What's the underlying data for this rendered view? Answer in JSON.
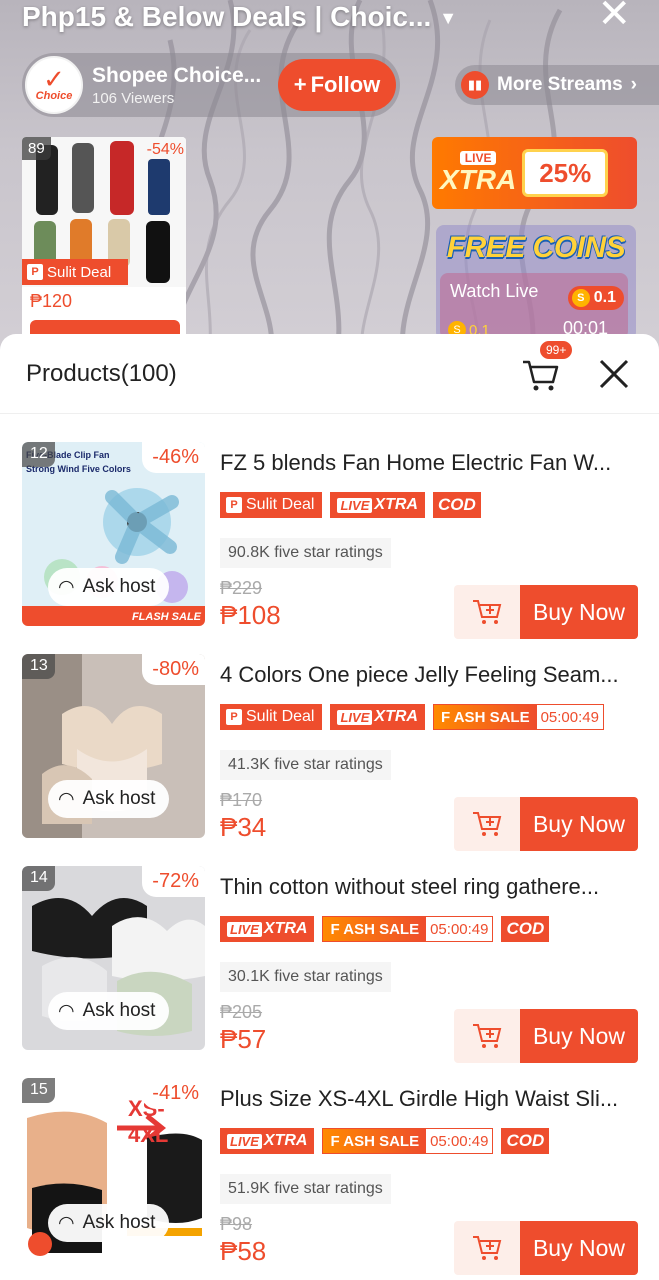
{
  "stream": {
    "title": "Php15 & Below Deals | Choic...",
    "host_name": "Shopee Choice...",
    "host_logo_text": "Choice",
    "viewers": "106 Viewers",
    "follow_label": "Follow",
    "more_streams_label": "More Streams"
  },
  "pinned": {
    "number": "89",
    "discount": "-54%",
    "tag": "Sulit Deal",
    "price": "₱120"
  },
  "xtra_banner": {
    "live": "LIVE",
    "xtra": "XTRA",
    "coupon": "25%"
  },
  "coins": {
    "title": "FREE COINS",
    "label": "Watch Live",
    "amount": "0.1",
    "amount2": "0.1",
    "timer": "00:01"
  },
  "sheet": {
    "title": "Products(100)",
    "cart_badge": "99+",
    "ask_host_label": "Ask host",
    "buy_label": "Buy Now"
  },
  "products": [
    {
      "number": "12",
      "discount": "-46%",
      "name": "FZ 5 blends Fan Home Electric Fan W...",
      "tags": [
        "Sulit Deal",
        "XTRA",
        "COD"
      ],
      "ratings": "90.8K five star ratings",
      "old_price": "₱229",
      "price": "₱108",
      "img_text": "Five-Blade Clip Fan Strong Wind Five Colors",
      "flash_sale_text": "FLASH SALE"
    },
    {
      "number": "13",
      "discount": "-80%",
      "name": "4 Colors One piece Jelly Feeling Seam...",
      "tags": [
        "Sulit Deal",
        "XTRA",
        "FLASH SALE"
      ],
      "flash_timer": "05:00:49",
      "ratings": "41.3K five star ratings",
      "old_price": "₱170",
      "price": "₱34"
    },
    {
      "number": "14",
      "discount": "-72%",
      "name": "Thin cotton without steel ring gathere...",
      "tags": [
        "XTRA",
        "FLASH SALE",
        "COD"
      ],
      "flash_timer": "05:00:49",
      "ratings": "30.1K five star ratings",
      "old_price": "₱205",
      "price": "₱57"
    },
    {
      "number": "15",
      "discount": "-41%",
      "name": "Plus Size XS-4XL Girdle High Waist Sli...",
      "tags": [
        "XTRA",
        "FLASH SALE",
        "COD"
      ],
      "flash_timer": "05:00:49",
      "ratings": "51.9K five star ratings",
      "old_price": "₱98",
      "price": "₱58",
      "img_text": "XS-4XL"
    }
  ],
  "tag_labels": {
    "live": "LIVE",
    "xtra": "XTRA",
    "flash": "F ASH SALE",
    "cod": "COD",
    "sulit": "Sulit Deal"
  },
  "colors": {
    "accent": "#ee4d2d",
    "xtra_gradient_start": "#ff7a00",
    "coins_gold": "#ffd23a"
  }
}
